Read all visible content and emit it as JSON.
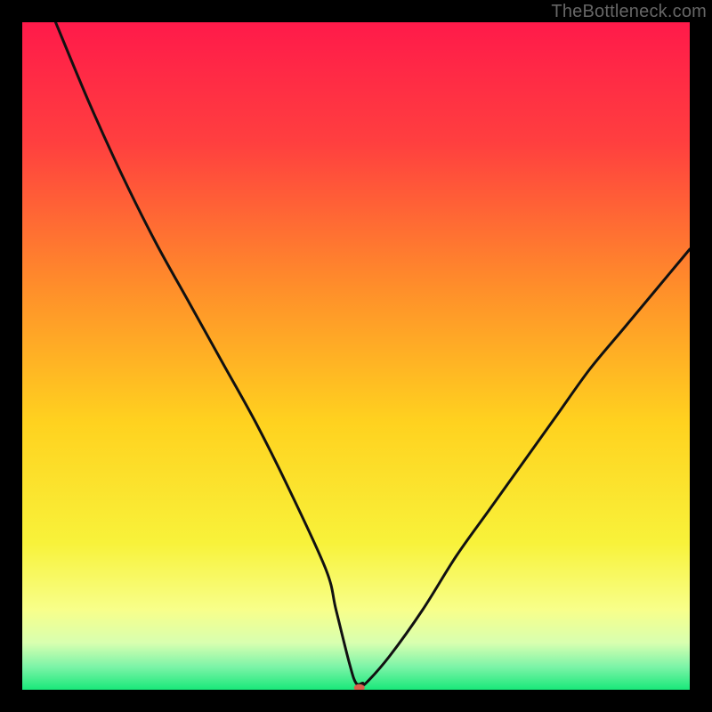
{
  "watermark": "TheBottleneck.com",
  "chart_data": {
    "type": "line",
    "title": "",
    "xlabel": "",
    "ylabel": "",
    "xlim": [
      0,
      100
    ],
    "ylim": [
      0,
      100
    ],
    "grid": false,
    "legend": false,
    "series": [
      {
        "name": "bottleneck-curve",
        "x": [
          5,
          10,
          15,
          20,
          25,
          30,
          35,
          40,
          45.5,
          47,
          49,
          50,
          51,
          51.5,
          55,
          60,
          65,
          70,
          75,
          80,
          85,
          90,
          95,
          100
        ],
        "values": [
          100,
          88,
          77,
          67,
          58,
          49,
          40,
          30,
          18,
          12,
          4,
          1,
          1,
          1,
          5,
          12,
          20,
          27,
          34,
          41,
          48,
          54,
          60,
          66
        ]
      }
    ],
    "marker": {
      "x": 50.5,
      "y": 0.3,
      "color": "#d9604c",
      "rx": 6,
      "ry": 4
    },
    "gradient_stops": [
      {
        "offset": 0,
        "color": "#ff1a4a"
      },
      {
        "offset": 0.18,
        "color": "#ff3f3f"
      },
      {
        "offset": 0.4,
        "color": "#ff8f2a"
      },
      {
        "offset": 0.6,
        "color": "#ffd21f"
      },
      {
        "offset": 0.78,
        "color": "#f8f23a"
      },
      {
        "offset": 0.88,
        "color": "#f8ff8a"
      },
      {
        "offset": 0.93,
        "color": "#d8ffb0"
      },
      {
        "offset": 0.965,
        "color": "#7ef4a8"
      },
      {
        "offset": 1.0,
        "color": "#19e87a"
      }
    ]
  }
}
